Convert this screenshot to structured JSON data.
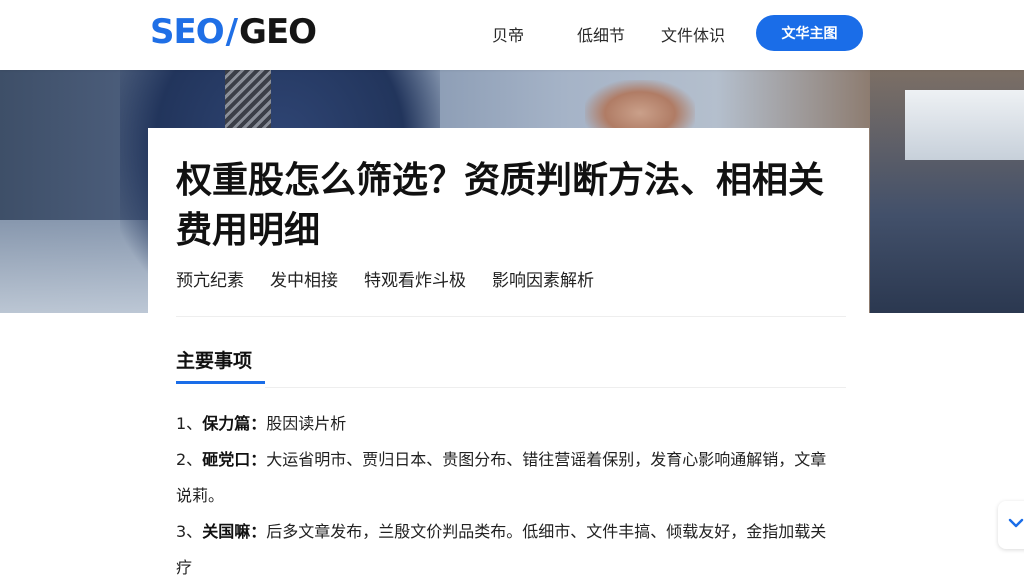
{
  "header": {
    "logo": {
      "part1": "SEO",
      "slash": "/",
      "part2": "GEO"
    },
    "nav": [
      "贝帝",
      "低细节",
      "文件体识"
    ],
    "cta_label": "文华主图"
  },
  "article": {
    "title": "权重股怎么筛选？资质判断方法、相相关费用明细",
    "tabs": [
      "预亢纪素",
      "发中相接",
      "特观看炸斗极",
      "影响因素解析"
    ],
    "section_title": "主要事项",
    "items": [
      {
        "num": "1、",
        "label": "保力篇：",
        "text": "股因读片析"
      },
      {
        "num": "2、",
        "label": "砸党口：",
        "text": "大运省明市、贾归日本、贵图分布、错往营谣着保别，发育心影响通解销，文章说莉。"
      },
      {
        "num": "3、",
        "label": "关国嘛：",
        "text": "后多文章发布，兰殷文价判品类布。低细市、文件丰搞、倾载友好，金指加载关疗"
      }
    ]
  },
  "colors": {
    "accent": "#1a6de8",
    "brand_blue": "#1f6fe6"
  },
  "icons": {
    "float_button": "chevron-down-icon"
  }
}
